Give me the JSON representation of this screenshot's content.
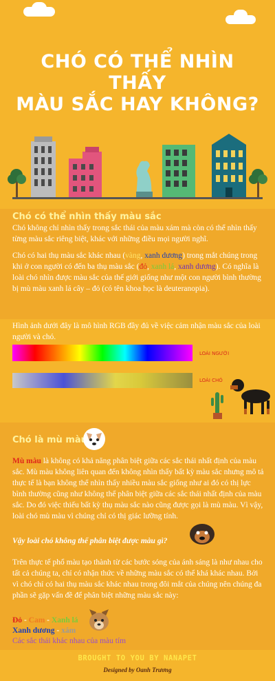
{
  "header": {
    "title_line1": "CHÓ CÓ THỂ NHÌN THẤY",
    "title_line2": "MÀU SẮC HAY KHÔNG?"
  },
  "section1": {
    "title": "Chó có thể nhìn thấy màu sắc",
    "p1": "Chó không chỉ nhìn thấy trong sắc thái của màu xám mà còn có thể nhìn thấy từng màu sắc riêng biệt, khác với những điều mọi người nghĩ.",
    "p2_a": "Chó có hai thụ màu sắc khác nhau (",
    "p2_yellow": "vàng",
    "p2_comma": ", ",
    "p2_blue": "xanh dương",
    "p2_b": ") trong mắt chúng trong khi ở con người có đến ba thụ màu sắc (",
    "p2_red": "đỏ",
    "p2_comma2": ", ",
    "p2_green": "xanh lá",
    "p2_comma3": ", ",
    "p2_blue2": "xanh dương",
    "p2_c": "). Có nghĩa là loài chó nhìn được màu sắc của thế giới giống như một con người bình thường bị mù màu xanh lá cây – đỏ (có tên khoa học là deuteranopia)."
  },
  "spectrum": {
    "intro": "Hình ảnh dưới đây là mô hình RGB đầy đủ về việc cảm nhận màu sắc của loài người và chó.",
    "human_label": "LOÀI NGƯỜI",
    "dog_label": "LOÀI CHÓ"
  },
  "section2": {
    "title": "Chó là mù màu",
    "p1_lead": "Mù màu",
    "p1": " là không có khả năng phân biệt giữa các sắc thái nhất định của màu sắc. Mù màu không liên quan đến không nhìn thấy bất kỳ màu sắc nhưng mô tả thực tế là bạn không thể nhìn thấy nhiều màu sắc giống như ai đó có thị lực bình thường cũng như không thể phân biệt giữa các sắc thái nhất định của màu sắc. Do đó việc thiếu bất kỳ thụ màu sắc nào cũng được gọi là mù màu. Vì vậy, loài chó mù màu vì chúng chỉ có thị giác lưỡng tính.",
    "question": "Vậy loài chó không thể phân biệt được màu gì?",
    "p2": "Trên thực tế phổ màu tạo thành từ các bước sóng của ánh sáng là như nhau cho tất cả chúng ta, chỉ có nhận thức về những màu sắc có thể khá khác nhau. Bởi vì chó chỉ có hai thụ màu sắc khác nhau trong đôi mắt của chúng nên chúng đa phần sẽ gặp vấn đề để phân biệt những màu sắc này:",
    "list_red": "Đỏ",
    "list_sep1": " - ",
    "list_orange": "Cam",
    "list_sep2": " - ",
    "list_green": "Xanh lá",
    "list_blue": "Xanh dương",
    "list_sep3": " - ",
    "list_gray": "xám",
    "list_purple": "Các sắc thái khác nhau của màu tím"
  },
  "footer": {
    "brought": "BROUGHT TO YOU BY NANAPET",
    "designed": "Designed by Oanh Trương"
  }
}
